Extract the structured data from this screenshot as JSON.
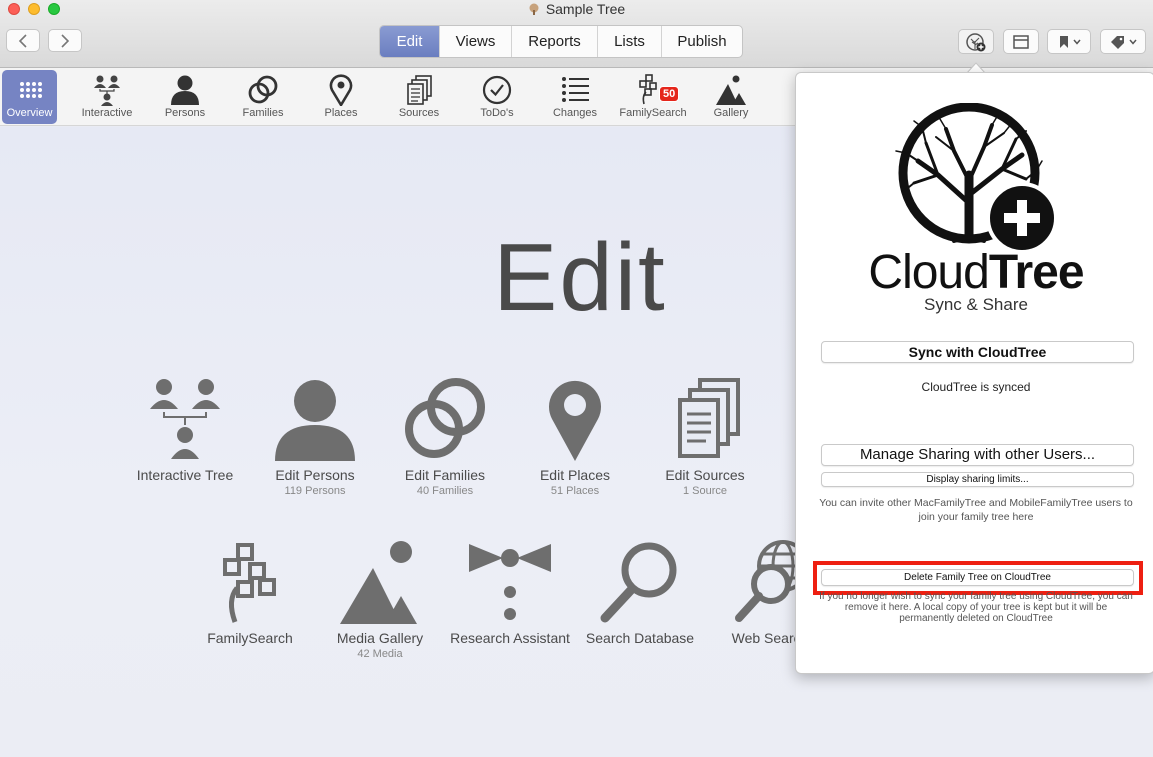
{
  "window": {
    "title": "Sample Tree"
  },
  "segments": [
    {
      "label": "Edit",
      "active": true
    },
    {
      "label": "Views",
      "active": false
    },
    {
      "label": "Reports",
      "active": false
    },
    {
      "label": "Lists",
      "active": false
    },
    {
      "label": "Publish",
      "active": false
    }
  ],
  "toolbar_items": [
    {
      "label": "Overview",
      "icon": "grid-icon"
    },
    {
      "label": "Interactive",
      "icon": "interactive-tree-icon"
    },
    {
      "label": "Persons",
      "icon": "person-icon"
    },
    {
      "label": "Families",
      "icon": "rings-icon"
    },
    {
      "label": "Places",
      "icon": "pin-icon"
    },
    {
      "label": "Sources",
      "icon": "documents-icon"
    },
    {
      "label": "ToDo's",
      "icon": "check-circle-icon"
    },
    {
      "label": "Changes",
      "icon": "list-icon"
    },
    {
      "label": "FamilySearch",
      "icon": "familysearch-icon",
      "badge": "50"
    },
    {
      "label": "Gallery",
      "icon": "mountain-icon"
    }
  ],
  "main": {
    "title": "Edit",
    "tiles": [
      {
        "label": "Interactive Tree",
        "sub": "",
        "icon": "interactive-tree-icon"
      },
      {
        "label": "Edit Persons",
        "sub": "119 Persons",
        "icon": "person-icon"
      },
      {
        "label": "Edit Families",
        "sub": "40 Families",
        "icon": "rings-icon"
      },
      {
        "label": "Edit Places",
        "sub": "51 Places",
        "icon": "pin-icon"
      },
      {
        "label": "Edit Sources",
        "sub": "1 Source",
        "icon": "documents-icon"
      },
      {
        "label": "FamilySearch",
        "sub": "",
        "icon": "familysearch-icon"
      },
      {
        "label": "Media Gallery",
        "sub": "42 Media",
        "icon": "mountain-icon"
      },
      {
        "label": "Research Assistant",
        "sub": "",
        "icon": "bowtie-icon"
      },
      {
        "label": "Search Database",
        "sub": "",
        "icon": "magnifier-icon"
      },
      {
        "label": "Web Search",
        "sub": "",
        "icon": "web-search-icon"
      }
    ]
  },
  "cloudtree": {
    "brand_light": "Cloud",
    "brand_bold": "Tree",
    "tagline": "Sync & Share",
    "sync_button": "Sync with CloudTree",
    "status": "CloudTree is synced",
    "manage_button": "Manage Sharing with other Users...",
    "limits_button": "Display sharing limits...",
    "invite_text": "You can invite other MacFamilyTree and MobileFamilyTree users to join your family tree here",
    "delete_button": "Delete Family Tree on CloudTree",
    "delete_note": "If you no longer wish to sync your family tree using CloudTree, you can remove it here. A local copy of your tree is kept but it will be permanently deleted on CloudTree"
  },
  "colors": {
    "accent": "#7684c3",
    "highlight": "#ee1f11",
    "badge": "#e5261b",
    "icon_gray": "#6e6e6e"
  }
}
